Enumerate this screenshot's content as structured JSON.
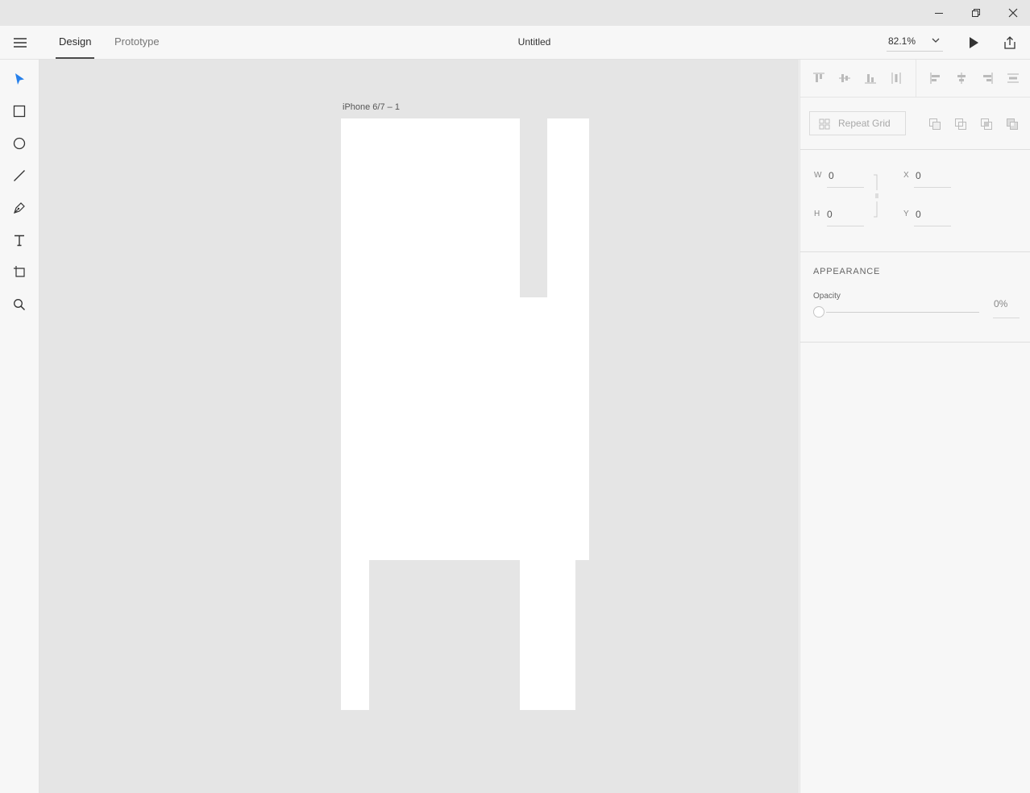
{
  "window": {
    "controls": [
      {
        "name": "minimize-icon"
      },
      {
        "name": "restore-icon"
      },
      {
        "name": "close-icon"
      }
    ]
  },
  "menubar": {
    "tabs": [
      {
        "label": "Design",
        "active": true
      },
      {
        "label": "Prototype",
        "active": false
      }
    ],
    "document_title": "Untitled",
    "zoom": "82.1%"
  },
  "tools": [
    {
      "name": "select-tool",
      "icon": "arrow-pointer-icon",
      "active": true
    },
    {
      "name": "rectangle-tool",
      "icon": "rectangle-icon"
    },
    {
      "name": "ellipse-tool",
      "icon": "ellipse-icon"
    },
    {
      "name": "line-tool",
      "icon": "line-icon"
    },
    {
      "name": "pen-tool",
      "icon": "pen-icon"
    },
    {
      "name": "text-tool",
      "icon": "text-icon"
    },
    {
      "name": "artboard-tool",
      "icon": "artboard-icon"
    },
    {
      "name": "zoom-tool",
      "icon": "magnifier-icon"
    }
  ],
  "canvas": {
    "artboard_label": "iPhone 6/7 – 1"
  },
  "properties": {
    "repeat_grid_label": "Repeat Grid",
    "dimensions": {
      "w_label": "W",
      "w_value": "0",
      "h_label": "H",
      "h_value": "0",
      "x_label": "X",
      "x_value": "0",
      "y_label": "Y",
      "y_value": "0"
    },
    "appearance": {
      "title": "APPEARANCE",
      "opacity_label": "Opacity",
      "opacity_value": "0%",
      "opacity_fraction": 0
    }
  },
  "colors": {
    "accent": "#2680eb",
    "canvas": "#e5e5e5",
    "artboard": "#ffffff"
  }
}
